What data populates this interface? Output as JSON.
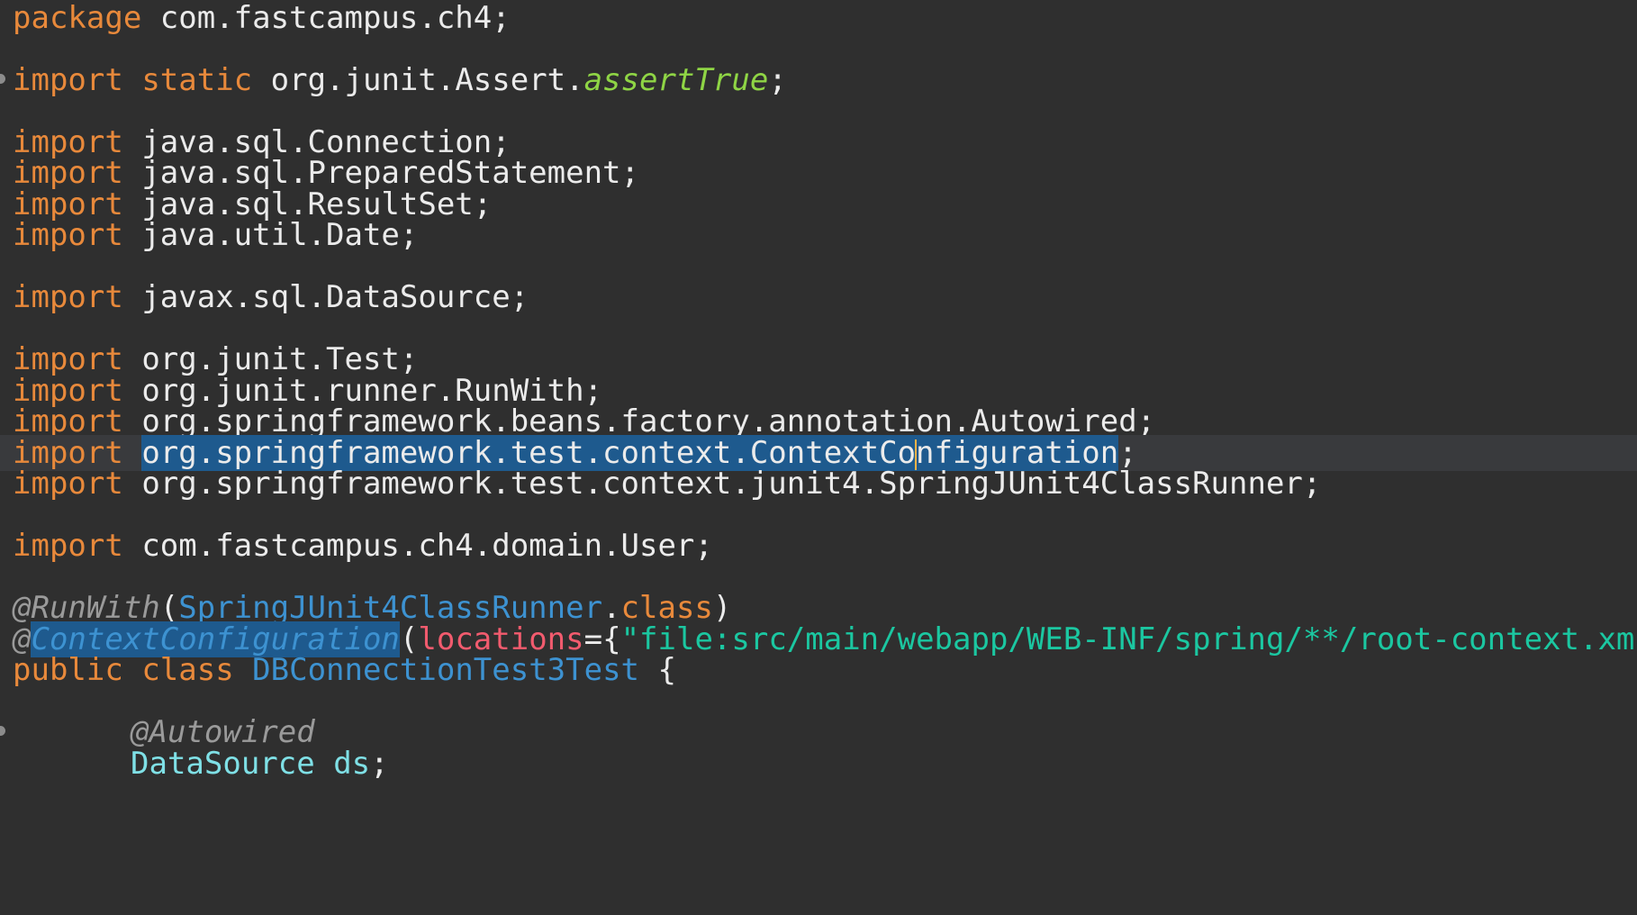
{
  "editor": {
    "lines": [
      {
        "id": "l1",
        "segments": [
          "package",
          "com.fastcampus.ch4;"
        ]
      },
      {
        "id": "l2",
        "segments": [
          "import",
          "static",
          "org.junit.Assert.",
          "assertTrue",
          ";"
        ]
      },
      {
        "id": "l3",
        "segments": [
          "import",
          "java.sql.Connection;"
        ]
      },
      {
        "id": "l4",
        "segments": [
          "import",
          "java.sql.PreparedStatement;"
        ]
      },
      {
        "id": "l5",
        "segments": [
          "import",
          "java.sql.ResultSet;"
        ]
      },
      {
        "id": "l6",
        "segments": [
          "import",
          "java.util.Date;"
        ]
      },
      {
        "id": "l7",
        "segments": [
          "import",
          "javax.sql.DataSource;"
        ]
      },
      {
        "id": "l8",
        "segments": [
          "import",
          "org.junit.Test;"
        ]
      },
      {
        "id": "l9",
        "segments": [
          "import",
          "org.junit.runner.RunWith;"
        ]
      },
      {
        "id": "l10",
        "segments": [
          "import",
          "org.springframework.beans.factory.annotation.Autowired;"
        ]
      },
      {
        "id": "l11",
        "segments": [
          "import",
          "org.springframework.test.context.ContextCo",
          "nfiguration",
          ";"
        ]
      },
      {
        "id": "l12",
        "segments": [
          "import",
          "org.springframework.test.context.junit4.SpringJUnit4ClassRunner;"
        ]
      },
      {
        "id": "l13",
        "segments": [
          "import",
          "com.fastcampus.ch4.domain.User;"
        ]
      },
      {
        "id": "l14",
        "segments": [
          "@RunWith",
          "(",
          "SpringJUnit4ClassRunner",
          ".",
          "class",
          ")"
        ]
      },
      {
        "id": "l15",
        "segments": [
          "@",
          "ContextConfiguration",
          "(",
          "locations",
          "={",
          "\"file:src/main/webapp/WEB-INF/spring/**/root-context.xml\"",
          "})"
        ]
      },
      {
        "id": "l16",
        "segments": [
          "public",
          "class",
          "DBConnectionTest3Test",
          "{"
        ]
      },
      {
        "id": "l17",
        "segments": [
          "@Autowired"
        ]
      },
      {
        "id": "l18",
        "segments": [
          "DataSource",
          "ds",
          ";"
        ]
      }
    ]
  },
  "colors": {
    "background": "#2f2f2f",
    "keyword": "#e8893b",
    "selection": "#1e5a8e",
    "string": "#1bc7a1"
  }
}
